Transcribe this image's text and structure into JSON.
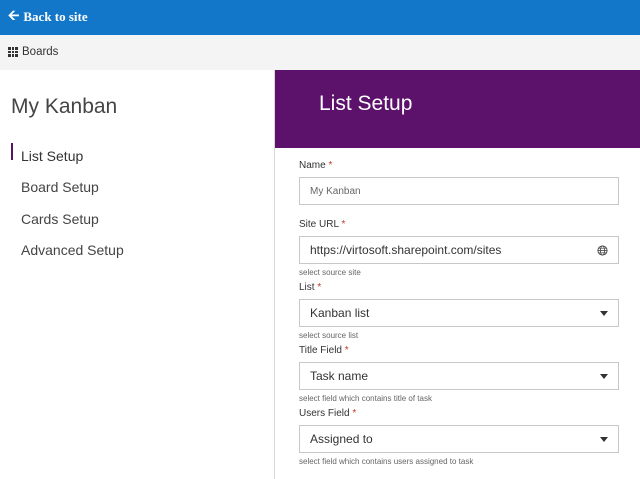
{
  "topbar": {
    "back_label": "Back to site",
    "back_icon": "arrow-left-icon",
    "color": "#1377c9"
  },
  "subbar": {
    "boards_label": "Boards",
    "boards_icon": "grid-icon"
  },
  "sidebar": {
    "title": "My Kanban",
    "items": [
      {
        "label": "List Setup",
        "active": true
      },
      {
        "label": "Board Setup",
        "active": false
      },
      {
        "label": "Cards Setup",
        "active": false
      },
      {
        "label": "Advanced Setup",
        "active": false
      }
    ]
  },
  "panel": {
    "title": "List Setup",
    "header_color": "#5c126b",
    "fields": {
      "name": {
        "label": "Name",
        "required_mark": "*",
        "value": "My Kanban"
      },
      "site_url": {
        "label": "Site URL",
        "required_mark": "*",
        "value": "https://virtosoft.sharepoint.com/sites",
        "help": "select source site",
        "icon": "globe-icon"
      },
      "list": {
        "label": "List",
        "required_mark": "*",
        "value": "Kanban list",
        "help": "select source list"
      },
      "title_field": {
        "label": "Title Field",
        "required_mark": "*",
        "value": "Task name",
        "help": "select field which contains title of task"
      },
      "users_field": {
        "label": "Users Field",
        "required_mark": "*",
        "value": "Assigned to",
        "help": "select field which contains users assigned to task"
      }
    }
  }
}
